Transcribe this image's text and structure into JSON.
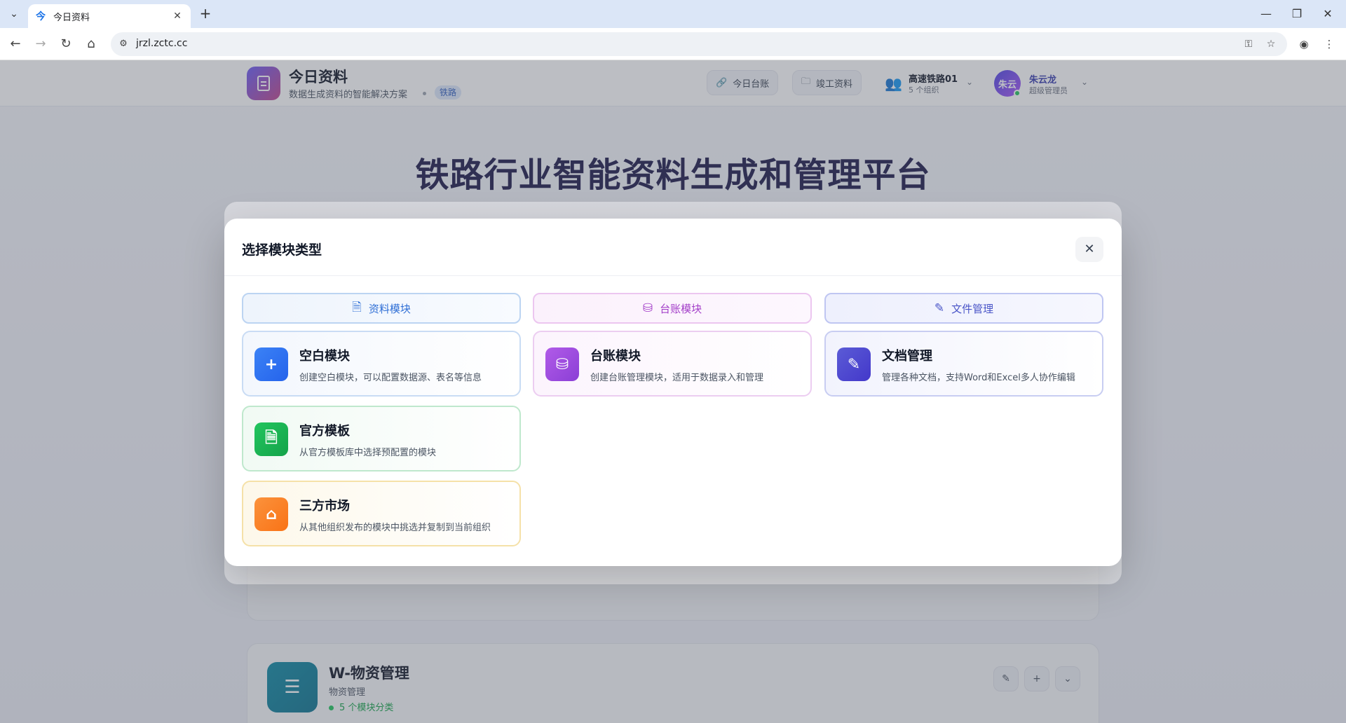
{
  "browser": {
    "tab_title": "今日资料",
    "tab_favicon": "今",
    "url": "jrzl.zctc.cc"
  },
  "header": {
    "brand_name": "今日资料",
    "brand_subtitle": "数据生成资料的智能解决方案",
    "brand_tag": "铁路",
    "btn_ledger": "今日台账",
    "btn_completion": "竣工资料",
    "org_name": "高速铁路01",
    "org_count": "5 个组织",
    "user_avatar_text": "朱云",
    "user_name": "朱云龙",
    "user_role": "超级管理员"
  },
  "hero": {
    "title": "铁路行业智能资料生成和管理平台"
  },
  "background_card": {
    "title": "W-物资管理",
    "subtitle": "物资管理",
    "count": "5 个模块分类"
  },
  "modal": {
    "title": "选择模块类型",
    "categories": [
      {
        "label": "资料模块",
        "icon": "document-icon"
      },
      {
        "label": "台账模块",
        "icon": "database-icon"
      },
      {
        "label": "文件管理",
        "icon": "file-edit-icon"
      }
    ],
    "cards": {
      "blank": {
        "title": "空白模块",
        "desc": "创建空白模块，可以配置数据源、表名等信息",
        "icon": "plus-icon"
      },
      "ledger": {
        "title": "台账模块",
        "desc": "创建台账管理模块，适用于数据录入和管理",
        "icon": "database-icon"
      },
      "docs": {
        "title": "文档管理",
        "desc": "管理各种文档，支持Word和Excel多人协作编辑",
        "icon": "file-edit-icon"
      },
      "official": {
        "title": "官方模板",
        "desc": "从官方模板库中选择预配置的模块",
        "icon": "document-icon"
      },
      "market": {
        "title": "三方市场",
        "desc": "从其他组织发布的模块中挑选并复制到当前组织",
        "icon": "store-icon"
      }
    }
  },
  "colors": {
    "blue": "#3b82f6",
    "purple": "#a855f7",
    "indigo": "#4f46e5",
    "green": "#22c55e",
    "orange": "#f97316"
  }
}
